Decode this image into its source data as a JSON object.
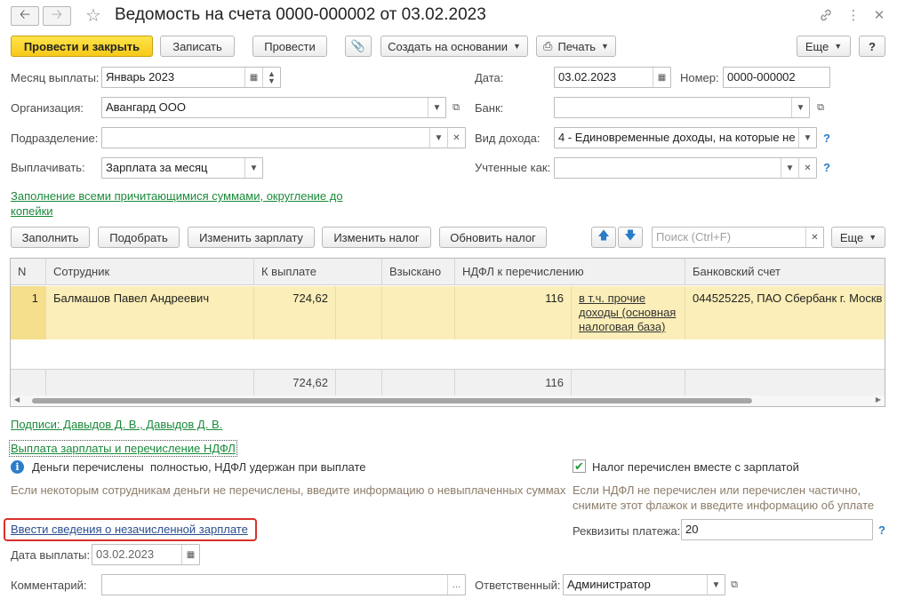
{
  "window": {
    "title": "Ведомость на счета 0000-000002 от 03.02.2023",
    "icons": [
      "arrow-left-icon",
      "arrow-right-icon",
      "star-icon",
      "link-icon",
      "more-vertical-icon",
      "close-icon"
    ]
  },
  "toolbar": {
    "post_close": "Провести и закрыть",
    "save": "Записать",
    "post": "Провести",
    "create_based": "Создать на основании",
    "print": "Печать",
    "more": "Еще",
    "help": "?"
  },
  "form": {
    "month_label": "Месяц выплаты:",
    "month_value": "Январь 2023",
    "date_label": "Дата:",
    "date_value": "03.02.2023",
    "number_label": "Номер:",
    "number_value": "0000-000002",
    "org_label": "Организация:",
    "org_value": "Авангард ООО",
    "bank_label": "Банк:",
    "bank_value": "",
    "dept_label": "Подразделение:",
    "dept_value": "",
    "income_label": "Вид дохода:",
    "income_value": "4 - Единовременные доходы, на которые не",
    "pay_label": "Выплачивать:",
    "pay_value": "Зарплата за месяц",
    "counted_label": "Учтенные как:",
    "counted_value": "",
    "fill_link_line1": "Заполнение всеми причитающимися суммами, округление до",
    "fill_link_line2": "копейки"
  },
  "table_toolbar": {
    "fill": "Заполнить",
    "pick": "Подобрать",
    "change_salary": "Изменить зарплату",
    "change_tax": "Изменить налог",
    "refresh_tax": "Обновить налог",
    "search_placeholder": "Поиск (Ctrl+F)",
    "more": "Еще"
  },
  "table": {
    "headers": [
      "N",
      "Сотрудник",
      "К выплате",
      "Взыскано",
      "НДФЛ к перечислению",
      "Банковский счет"
    ],
    "rows": [
      {
        "n": "1",
        "employee": "Балмашов Павел Андреевич",
        "to_pay": "724,62",
        "withheld": "",
        "ndfl": "116",
        "ndfl_link_1": "в т.ч. прочие",
        "ndfl_link_2": "доходы (основная",
        "ndfl_link_3": "налоговая база)",
        "account": "044525225, ПАО Сбербанк г. Москв"
      }
    ],
    "footer": {
      "to_pay": "724,62",
      "ndfl": "116"
    }
  },
  "bottom": {
    "signatures_link": "Подписи: Давыдов Д. В., Давыдов Д. В.",
    "payment_link": "Выплата зарплаты и перечисление НДФЛ",
    "money_status": "Деньги перечислены  полностью, НДФЛ удержан при выплате",
    "money_hint": "Если некоторым сотрудникам деньги не перечислены, введите информацию о невыплаченных суммах",
    "tax_checkbox_label": "Налог перечислен вместе с зарплатой",
    "tax_checkbox_checked": true,
    "tax_hint_1": "Если НДФЛ не перечислен или перечислен частично,",
    "tax_hint_2": "снимите этот флажок и введите информацию об уплате",
    "unaccrued_link": "Ввести сведения о незачисленной зарплате",
    "payment_details_label": "Реквизиты платежа:",
    "payment_details_value": "20",
    "pay_date_label": "Дата выплаты:",
    "pay_date_value": "03.02.2023",
    "comment_label": "Комментарий:",
    "comment_value": "",
    "responsible_label": "Ответственный:",
    "responsible_value": "Администратор"
  },
  "colors": {
    "primary_button": "#f6c919",
    "row_highlight": "#fbeeb8",
    "link_green": "#1a8a3a",
    "link_blue": "#2a4d8f",
    "highlight_box": "#d9312a"
  }
}
